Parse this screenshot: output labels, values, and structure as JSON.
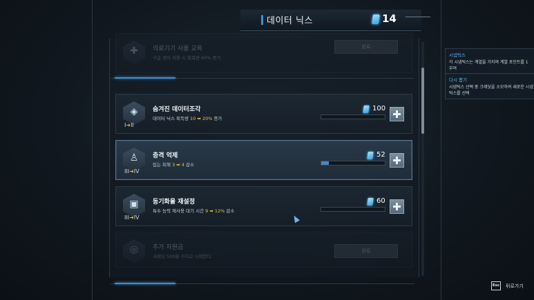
{
  "header": {
    "title": "데이터 닉스",
    "currency_count": "14",
    "currency_icon": "data-crystal-icon"
  },
  "items": [
    {
      "name": "의료기기 사용 교육",
      "desc_pre": "구급 생자 사용 시 회복량 60% 증가",
      "button": "완료",
      "state": "completed"
    },
    {
      "name": "숨겨진 데이터조각",
      "desc_pre": "데이터 닉스 획득량 ",
      "desc_from": "10",
      "desc_arrow": "➡",
      "desc_to": "20%",
      "desc_post": " 증가",
      "tier_from": "I",
      "tier_to": "II",
      "cost": "100",
      "progress": 0
    },
    {
      "name": "충격 억제",
      "desc_pre": "입는 피해 ",
      "desc_from": "3",
      "desc_arrow": "➡",
      "desc_to": "4",
      "desc_post": " 감소",
      "tier_from": "III",
      "tier_to": "IV",
      "cost": "52",
      "progress": 0.12
    },
    {
      "name": "동기화율 재설정",
      "desc_pre": "특수 능력 재사용 대기 시간 ",
      "desc_from": "9",
      "desc_arrow": "➡",
      "desc_to": "12%",
      "desc_post": " 감소",
      "tier_from": "III",
      "tier_to": "IV",
      "cost": "60",
      "progress": 0
    },
    {
      "name": "추가 자원금",
      "desc_pre": "크레딧 500을 가지고 시작한다.",
      "button": "완료",
      "state": "completed"
    }
  ],
  "info_panels": [
    {
      "title": "시냅틱스",
      "text": "각 시냅틱스는 계열을 가지며 계열 포인트를 1 부여"
    },
    {
      "title": "다시 뽑기",
      "text": "시냅틱스 선택 중 크레딧을 소모하여 새로운 시냅틱스를 선택"
    }
  ],
  "footer": {
    "key": "Esc",
    "label": "뒤로가기"
  },
  "colors": {
    "accent": "#3d8fd6",
    "highlight": "#f0c04a",
    "panel": "#1e2934"
  }
}
